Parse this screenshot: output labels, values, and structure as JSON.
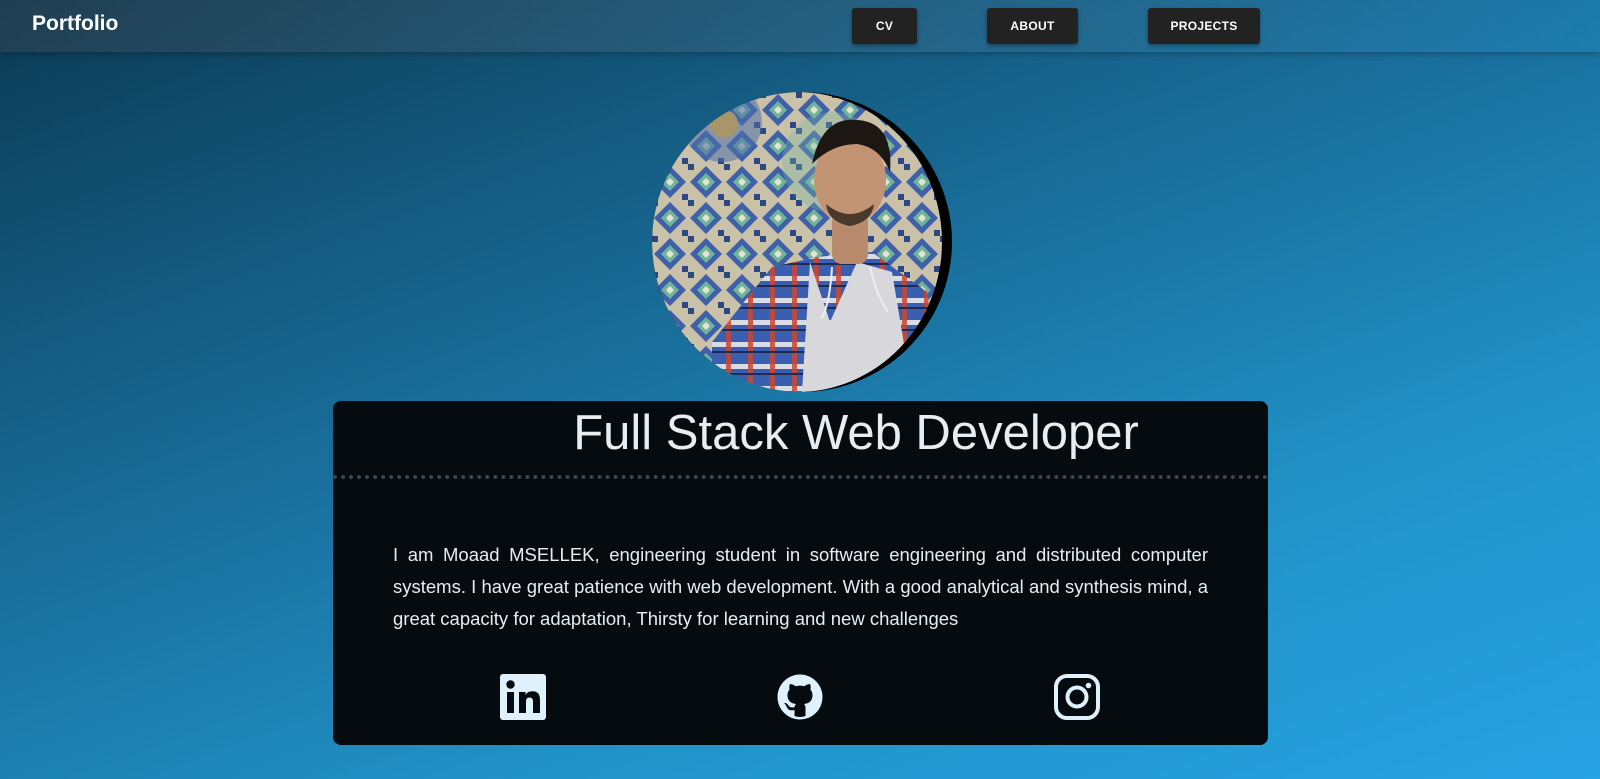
{
  "nav": {
    "brand": "Portfolio",
    "items": [
      {
        "label": "CV"
      },
      {
        "label": "ABOUT"
      },
      {
        "label": "PROJECTS"
      }
    ]
  },
  "profile": {
    "title": "Full Stack Web Developer",
    "bio": "I am Moaad MSELLEK, engineering student in software engineering and distributed computer systems. I have great patience with web development. With a good analytical and synthesis mind, a great capacity for adaptation, Thirsty for learning and new challenges"
  },
  "social": [
    {
      "icon": "linkedin-icon"
    },
    {
      "icon": "github-icon"
    },
    {
      "icon": "instagram-icon"
    }
  ],
  "colors": {
    "card_background": "#050b0f",
    "nav_button": "#222222",
    "gradient_start": "#0b3a52",
    "gradient_end": "#27a2e2",
    "icon_color": "#dff1fa"
  }
}
